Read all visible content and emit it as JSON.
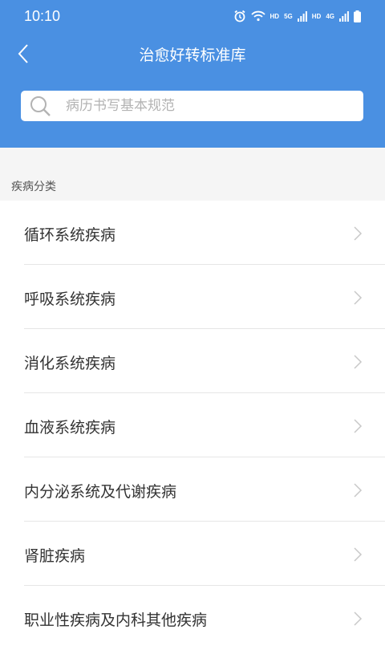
{
  "status_bar": {
    "time": "10:10",
    "hd1": "HD",
    "net1": "5G",
    "hd2": "HD",
    "net2": "4G"
  },
  "header": {
    "title": "治愈好转标准库"
  },
  "search": {
    "placeholder": "病历书写基本规范"
  },
  "section": {
    "title": "疾病分类"
  },
  "items": [
    {
      "label": "循环系统疾病"
    },
    {
      "label": "呼吸系统疾病"
    },
    {
      "label": "消化系统疾病"
    },
    {
      "label": "血液系统疾病"
    },
    {
      "label": "内分泌系统及代谢疾病"
    },
    {
      "label": "肾脏疾病"
    },
    {
      "label": "职业性疾病及内科其他疾病"
    }
  ],
  "colors": {
    "header": "#4a90e2",
    "background": "#ffffff",
    "section_bg": "#f5f5f5"
  },
  "icons": [
    "alarm-icon",
    "wifi-icon",
    "signal-icon",
    "battery-icon",
    "back-arrow-icon",
    "search-icon",
    "chevron-right-icon"
  ]
}
